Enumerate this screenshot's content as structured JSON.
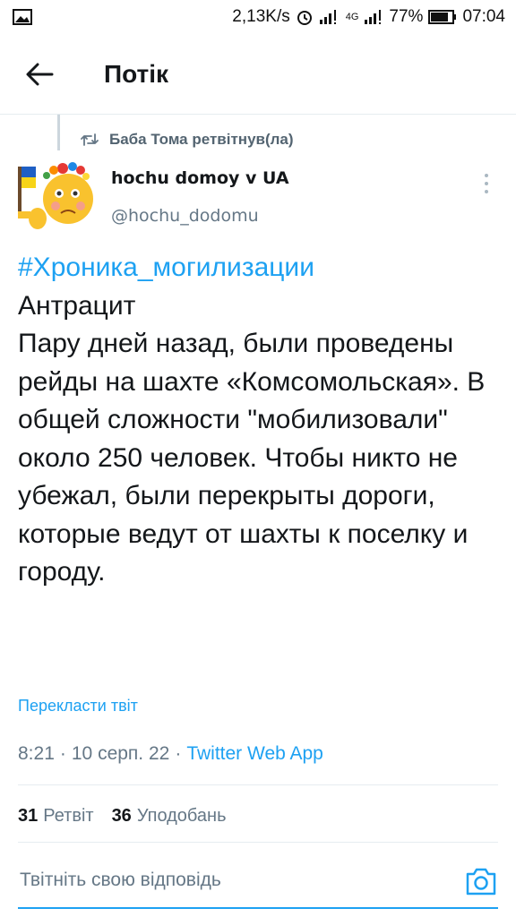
{
  "status_bar": {
    "speed": "2,13K/s",
    "network": "4G",
    "battery": "77%",
    "time": "07:04"
  },
  "header": {
    "title": "Потік"
  },
  "retweet": {
    "text": "Баба Тома ретвітнув(ла)"
  },
  "author": {
    "name": "hochu domoy v UA",
    "handle": "@hochu_dodomu"
  },
  "tweet": {
    "hashtag": "#Хроника_могилизации",
    "text": " Антрацит\nПару дней назад, были проведены рейды на шахте «Комсомольская». В общей сложности \"мобилизовали\" около 250 человек. Чтобы никто не убежал, были перекрыты дороги, которые ведут от шахты к поселку и городу.",
    "translate_label": "Перекласти твіт"
  },
  "meta": {
    "time": "8:21",
    "sep1": "·",
    "date": "10 серп. 22",
    "sep2": "·",
    "app": "Twitter Web App"
  },
  "stats": {
    "retweets_count": "31",
    "retweets_label": "Ретвіт",
    "likes_count": "36",
    "likes_label": "Уподобань"
  },
  "reply": {
    "placeholder": "Твітніть свою відповідь"
  },
  "colors": {
    "accent": "#1da1f2",
    "secondary_text": "#657786"
  }
}
